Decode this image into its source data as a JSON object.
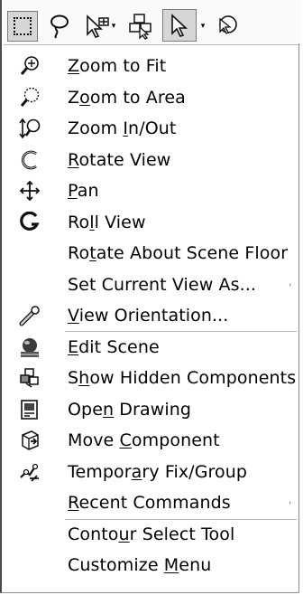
{
  "toolbar": {
    "tools": [
      "box-select",
      "lasso-select",
      "selection-filter",
      "component-select",
      "select-pointer",
      "magnifying-select"
    ],
    "active": [
      "box-select",
      "select-pointer"
    ]
  },
  "menu": {
    "items": [
      {
        "pre": "",
        "key": "Z",
        "post": "oom to Fit",
        "icon": "zoom-to-fit-icon"
      },
      {
        "pre": "Z",
        "key": "o",
        "post": "om to Area",
        "icon": "zoom-to-area-icon"
      },
      {
        "pre": "Zoom ",
        "key": "I",
        "post": "n/Out",
        "icon": "zoom-in-out-icon"
      },
      {
        "pre": "",
        "key": "R",
        "post": "otate View",
        "icon": "rotate-view-icon"
      },
      {
        "pre": "",
        "key": "P",
        "post": "an",
        "icon": "pan-icon"
      },
      {
        "pre": "Ro",
        "key": "l",
        "post": "l View",
        "icon": "roll-view-icon"
      },
      {
        "pre": "Ro",
        "key": "t",
        "post": "ate About Scene Floor",
        "icon": ""
      },
      {
        "pre": "Set Current View As...",
        "key": "",
        "post": "",
        "icon": "",
        "submenu": true
      },
      {
        "pre": "",
        "key": "V",
        "post": "iew Orientation...",
        "icon": "view-orientation-icon"
      },
      {
        "pre": "",
        "key": "E",
        "post": "dit Scene",
        "icon": "edit-scene-icon"
      },
      {
        "pre": "S",
        "key": "h",
        "post": "ow Hidden Components",
        "icon": "show-hidden-components-icon"
      },
      {
        "pre": "Ope",
        "key": "n",
        "post": " Drawing",
        "icon": "open-drawing-icon"
      },
      {
        "pre": "Move ",
        "key": "C",
        "post": "omponent",
        "icon": "move-component-icon"
      },
      {
        "pre": "Tempor",
        "key": "a",
        "post": "ry Fix/Group",
        "icon": "temporary-fix-icon"
      },
      {
        "pre": "",
        "key": "R",
        "post": "ecent Commands",
        "icon": "",
        "submenu": true
      },
      {
        "pre": "Conto",
        "key": "u",
        "post": "r Select Tool",
        "icon": ""
      },
      {
        "pre": "Customize ",
        "key": "M",
        "post": "enu",
        "icon": ""
      }
    ],
    "submenu_glyph": "›"
  }
}
